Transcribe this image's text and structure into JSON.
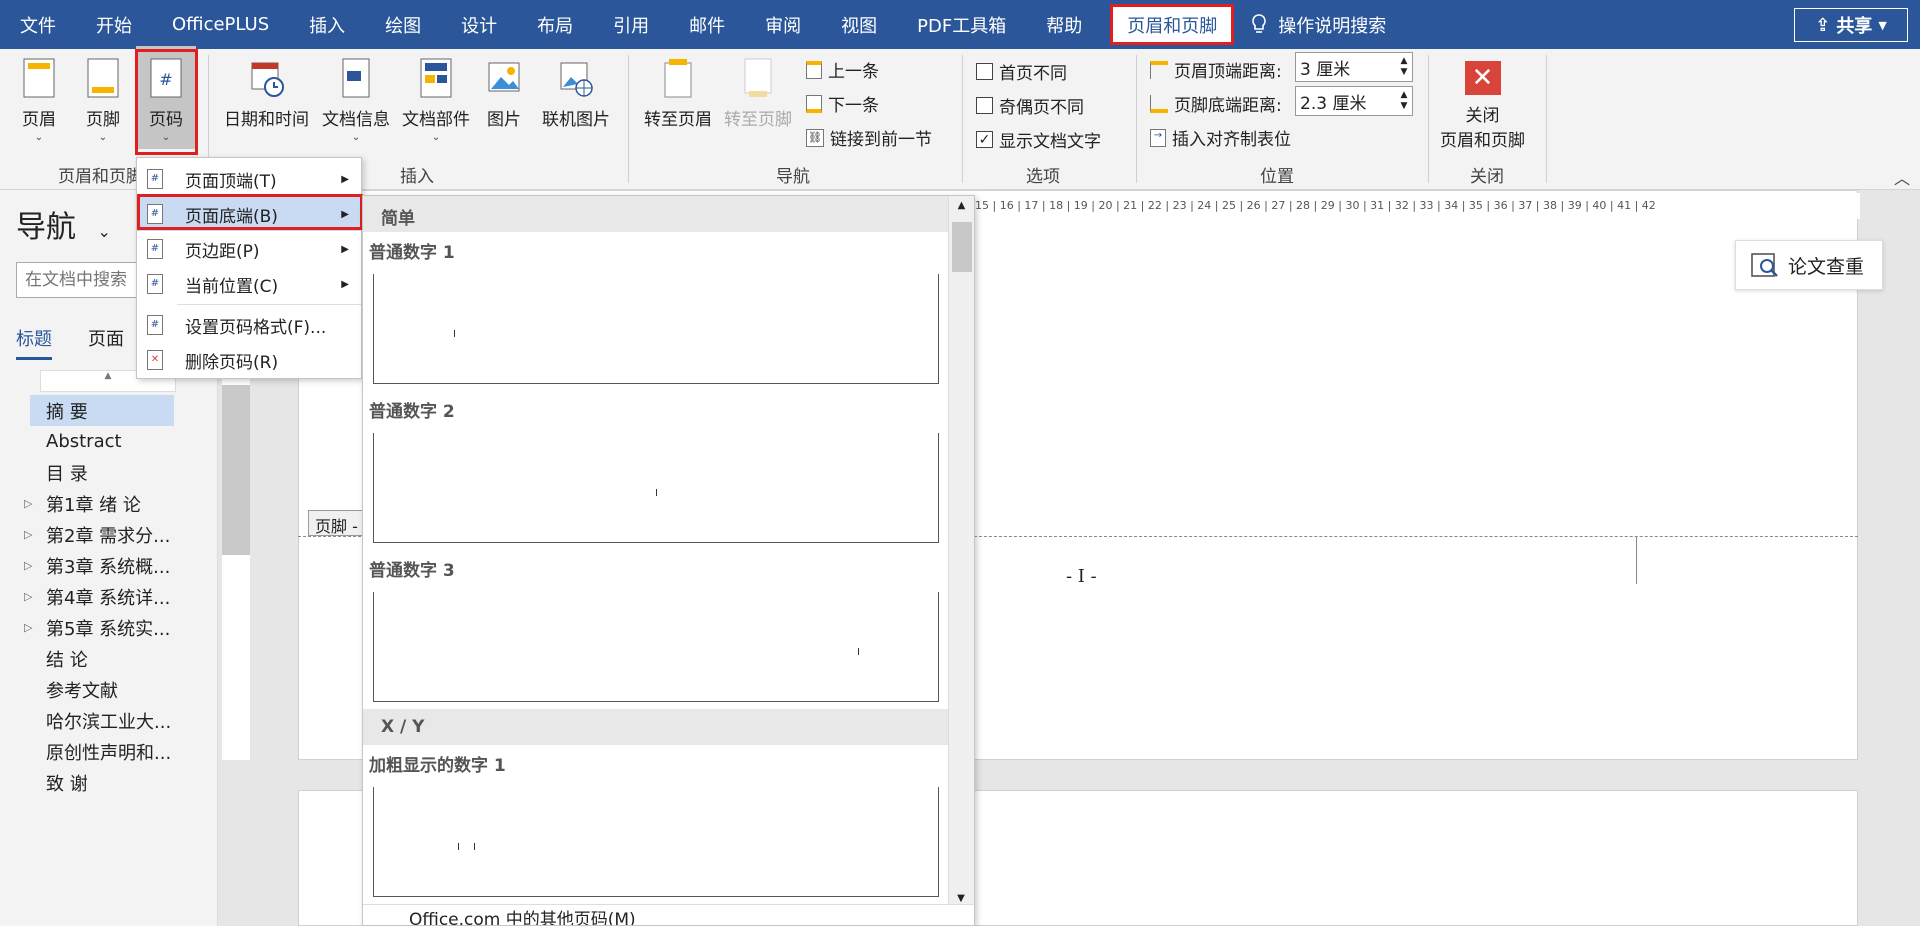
{
  "menubar": {
    "tabs": [
      "文件",
      "开始",
      "OfficePLUS",
      "插入",
      "绘图",
      "设计",
      "布局",
      "引用",
      "邮件",
      "审阅",
      "视图",
      "PDF工具箱",
      "帮助"
    ],
    "active_tab": "页眉和页脚",
    "tell_me": "操作说明搜索",
    "share": "共享"
  },
  "ribbon": {
    "header": "页眉",
    "footer": "页脚",
    "page_number": "页码",
    "group_hf": "页眉和页脚",
    "date_time": "日期和时间",
    "doc_info": "文档信息",
    "doc_parts": "文档部件",
    "picture": "图片",
    "online_picture": "联机图片",
    "group_insert": "插入",
    "goto_header": "转至页眉",
    "goto_footer": "转至页脚",
    "previous": "上一条",
    "next": "下一条",
    "link_prev": "链接到前一节",
    "group_nav": "导航",
    "first_page_diff": "首页不同",
    "odd_even_diff": "奇偶页不同",
    "show_doc_text": "显示文档文字",
    "group_options": "选项",
    "header_top_label": "页眉顶端距离:",
    "header_top_value": "3 厘米",
    "footer_bottom_label": "页脚底端距离:",
    "footer_bottom_value": "2.3 厘米",
    "insert_align_tab": "插入对齐制表位",
    "group_position": "位置",
    "close_label_1": "关闭",
    "close_label_2": "页眉和页脚",
    "group_close": "关闭"
  },
  "nav": {
    "title": "导航",
    "search_placeholder": "在文档中搜索",
    "tab_headings": "标题",
    "tab_pages": "页面",
    "items": [
      "摘  要",
      "Abstract",
      "目  录",
      "第1章  绪  论",
      "第2章  需求分...",
      "第3章  系统概...",
      "第4章  系统详...",
      "第5章  系统实...",
      "结  论",
      "参考文献",
      "哈尔滨工业大...",
      "原创性声明和...",
      "致  谢"
    ]
  },
  "page_number_menu": {
    "items": [
      "页面顶端(T)",
      "页面底端(B)",
      "页边距(P)",
      "当前位置(C)",
      "设置页码格式(F)...",
      "删除页码(R)"
    ]
  },
  "gallery": {
    "section_simple": "简单",
    "plain1": "普通数字 1",
    "plain2": "普通数字 2",
    "plain3": "普通数字 3",
    "section_xy": "X / Y",
    "bold1": "加粗显示的数字 1",
    "more": "Office.com 中的其他页码(M)"
  },
  "document": {
    "footer_tag": "页脚 -",
    "page_number_text": "- I -",
    "essay_check": "论文查重"
  },
  "ruler": "15 | 16 | 17 | 18 | 19 | 20 | 21 | 22 | 23 | 24 | 25 | 26 | 27 | 28 | 29 | 30 | 31 | 32 | 33 | 34 | 35 | 36 | 37 | 38 | 39 | 40 | 41 | 42",
  "colors": {
    "accent": "#2b579a",
    "highlight": "#e02020"
  }
}
